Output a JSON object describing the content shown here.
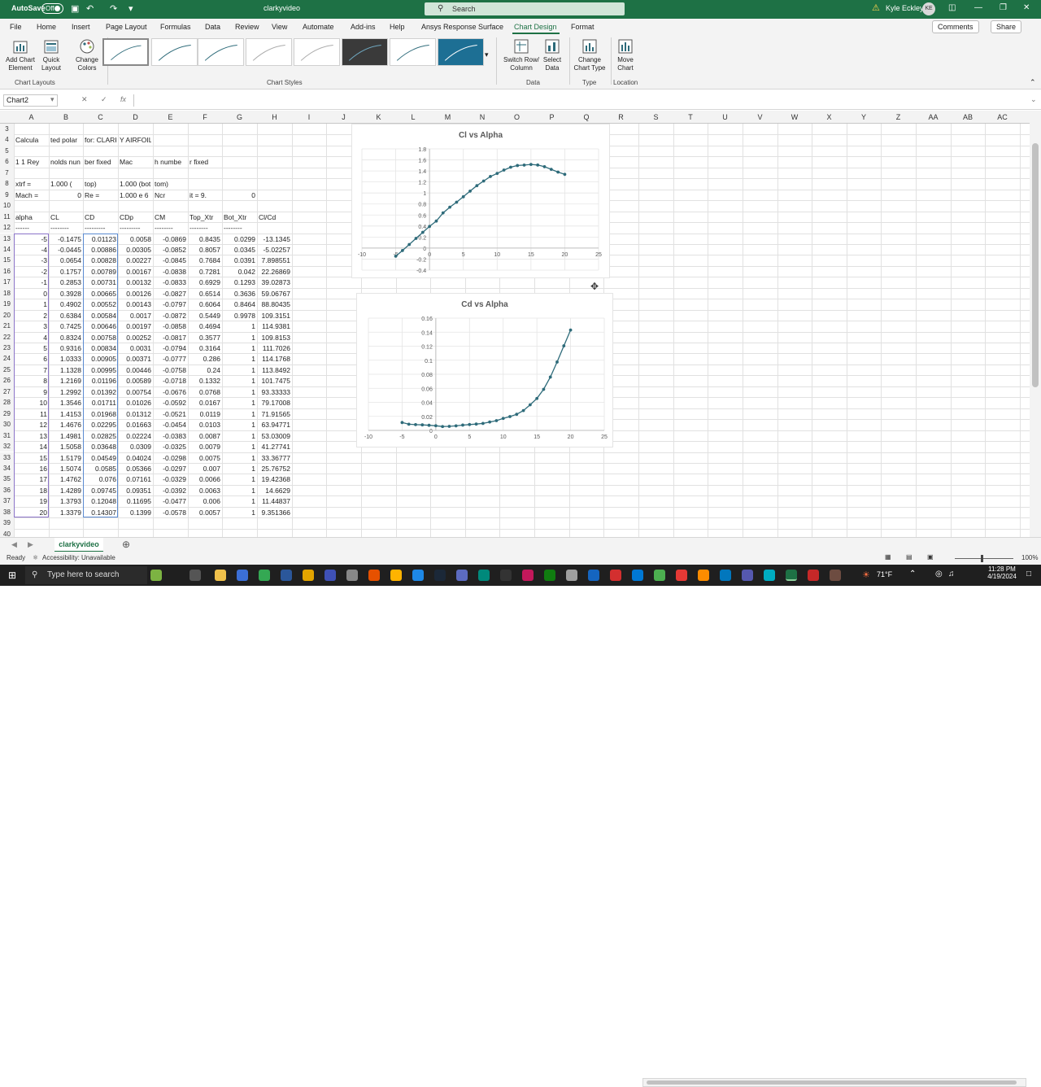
{
  "titlebar": {
    "autosave": "AutoSave",
    "toggle": "Off",
    "filename": "clarkyvideo",
    "search": "Search",
    "user": "Kyle Eckley",
    "initials": "KE"
  },
  "tabs": [
    "File",
    "Home",
    "Insert",
    "Page Layout",
    "Formulas",
    "Data",
    "Review",
    "View",
    "Automate",
    "Add-ins",
    "Help",
    "Ansys Response Surface",
    "Chart Design",
    "Format"
  ],
  "top_buttons": {
    "comments": "Comments",
    "share": "Share"
  },
  "ribbon": {
    "add_chart": "Add Chart Element",
    "quick_layout": "Quick Layout",
    "change_colors": "Change Colors",
    "switch_row": "Switch Row/ Column",
    "select_data": "Select Data",
    "change_type": "Change Chart Type",
    "move_chart": "Move Chart",
    "grp_layouts": "Chart Layouts",
    "grp_styles": "Chart Styles",
    "grp_data": "Data",
    "grp_type": "Type",
    "grp_location": "Location"
  },
  "namebox": "Chart2",
  "columns": [
    "A",
    "B",
    "C",
    "D",
    "E",
    "F",
    "G",
    "H",
    "I",
    "J",
    "K",
    "L",
    "M",
    "N",
    "O",
    "P",
    "Q",
    "R",
    "S",
    "T",
    "U",
    "V",
    "W",
    "X",
    "Y",
    "Z",
    "AA",
    "AB",
    "AC"
  ],
  "row_numbers": [
    "3",
    "4",
    "5",
    "6",
    "7",
    "8",
    "9",
    "10",
    "11",
    "12",
    "13",
    "14",
    "15",
    "16",
    "17",
    "18",
    "19",
    "20",
    "21",
    "22",
    "23",
    "24",
    "25",
    "26",
    "27",
    "28",
    "29",
    "30",
    "31",
    "32",
    "33",
    "34",
    "35",
    "36",
    "37",
    "38",
    "39",
    "40"
  ],
  "header_rows": [
    [
      "",
      "",
      "",
      "",
      "",
      "",
      "",
      ""
    ],
    [
      "Calcula",
      "ted polar",
      "for: CLARK",
      "Y AIRFOIL",
      "",
      "",
      "",
      ""
    ],
    [
      "",
      "",
      "",
      "",
      "",
      "",
      "",
      ""
    ],
    [
      "1 1 Rey",
      "nolds nun",
      "ber fixed",
      "Mac",
      "h numbe",
      "r fixed",
      "",
      ""
    ],
    [
      "",
      "",
      "",
      "",
      "",
      "",
      "",
      ""
    ],
    [
      "xtrf =",
      "1.000 (",
      "top)",
      "1.000 (bot",
      "tom)",
      "",
      "",
      ""
    ],
    [
      "Mach =",
      "0",
      "Re =",
      "1.000 e 6",
      "Ncr",
      "it =   9.",
      "0",
      ""
    ],
    [
      "",
      "",
      "",
      "",
      "",
      "",
      "",
      ""
    ],
    [
      "alpha",
      "CL",
      "CD",
      "CDp",
      "CM",
      "Top_Xtr",
      "Bot_Xtr",
      "Cl/Cd"
    ],
    [
      "------",
      "--------",
      "---------",
      "---------",
      "--------",
      "--------",
      "--------",
      ""
    ]
  ],
  "data_rows": [
    [
      "-5",
      "-0.1475",
      "0.01123",
      "0.0058",
      "-0.0869",
      "0.8435",
      "0.0299",
      "-13.1345"
    ],
    [
      "-4",
      "-0.0445",
      "0.00886",
      "0.00305",
      "-0.0852",
      "0.8057",
      "0.0345",
      "-5.02257"
    ],
    [
      "-3",
      "0.0654",
      "0.00828",
      "0.00227",
      "-0.0845",
      "0.7684",
      "0.0391",
      "7.898551"
    ],
    [
      "-2",
      "0.1757",
      "0.00789",
      "0.00167",
      "-0.0838",
      "0.7281",
      "0.042",
      "22.26869"
    ],
    [
      "-1",
      "0.2853",
      "0.00731",
      "0.00132",
      "-0.0833",
      "0.6929",
      "0.1293",
      "39.02873"
    ],
    [
      "0",
      "0.3928",
      "0.00665",
      "0.00126",
      "-0.0827",
      "0.6514",
      "0.3636",
      "59.06767"
    ],
    [
      "1",
      "0.4902",
      "0.00552",
      "0.00143",
      "-0.0797",
      "0.6064",
      "0.8464",
      "88.80435"
    ],
    [
      "2",
      "0.6384",
      "0.00584",
      "0.0017",
      "-0.0872",
      "0.5449",
      "0.9978",
      "109.3151"
    ],
    [
      "3",
      "0.7425",
      "0.00646",
      "0.00197",
      "-0.0858",
      "0.4694",
      "1",
      "114.9381"
    ],
    [
      "4",
      "0.8324",
      "0.00758",
      "0.00252",
      "-0.0817",
      "0.3577",
      "1",
      "109.8153"
    ],
    [
      "5",
      "0.9316",
      "0.00834",
      "0.0031",
      "-0.0794",
      "0.3164",
      "1",
      "111.7026"
    ],
    [
      "6",
      "1.0333",
      "0.00905",
      "0.00371",
      "-0.0777",
      "0.286",
      "1",
      "114.1768"
    ],
    [
      "7",
      "1.1328",
      "0.00995",
      "0.00446",
      "-0.0758",
      "0.24",
      "1",
      "113.8492"
    ],
    [
      "8",
      "1.2169",
      "0.01196",
      "0.00589",
      "-0.0718",
      "0.1332",
      "1",
      "101.7475"
    ],
    [
      "9",
      "1.2992",
      "0.01392",
      "0.00754",
      "-0.0676",
      "0.0768",
      "1",
      "93.33333"
    ],
    [
      "10",
      "1.3546",
      "0.01711",
      "0.01026",
      "-0.0592",
      "0.0167",
      "1",
      "79.17008"
    ],
    [
      "11",
      "1.4153",
      "0.01968",
      "0.01312",
      "-0.0521",
      "0.0119",
      "1",
      "71.91565"
    ],
    [
      "12",
      "1.4676",
      "0.02295",
      "0.01663",
      "-0.0454",
      "0.0103",
      "1",
      "63.94771"
    ],
    [
      "13",
      "1.4981",
      "0.02825",
      "0.02224",
      "-0.0383",
      "0.0087",
      "1",
      "53.03009"
    ],
    [
      "14",
      "1.5058",
      "0.03648",
      "0.0309",
      "-0.0325",
      "0.0079",
      "1",
      "41.27741"
    ],
    [
      "15",
      "1.5179",
      "0.04549",
      "0.04024",
      "-0.0298",
      "0.0075",
      "1",
      "33.36777"
    ],
    [
      "16",
      "1.5074",
      "0.0585",
      "0.05366",
      "-0.0297",
      "0.007",
      "1",
      "25.76752"
    ],
    [
      "17",
      "1.4762",
      "0.076",
      "0.07161",
      "-0.0329",
      "0.0066",
      "1",
      "19.42368"
    ],
    [
      "18",
      "1.4289",
      "0.09745",
      "0.09351",
      "-0.0392",
      "0.0063",
      "1",
      "14.6629"
    ],
    [
      "19",
      "1.3793",
      "0.12048",
      "0.11695",
      "-0.0477",
      "0.006",
      "1",
      "11.44837"
    ],
    [
      "20",
      "1.3379",
      "0.14307",
      "0.1399",
      "-0.0578",
      "0.0057",
      "1",
      "9.351366"
    ]
  ],
  "chart_data": [
    {
      "type": "scatter",
      "title": "Cl vs Alpha",
      "xlim": [
        -10,
        25
      ],
      "ylim": [
        -0.4,
        1.8
      ],
      "xticks": [
        "-10",
        "-5",
        "0",
        "5",
        "10",
        "15",
        "20",
        "25"
      ],
      "yticks": [
        "-0.4",
        "-0.2",
        "0",
        "0.2",
        "0.4",
        "0.6",
        "0.8",
        "1",
        "1.2",
        "1.4",
        "1.6",
        "1.8"
      ],
      "x": [
        -5,
        -4,
        -3,
        -2,
        -1,
        0,
        1,
        2,
        3,
        4,
        5,
        6,
        7,
        8,
        9,
        10,
        11,
        12,
        13,
        14,
        15,
        16,
        17,
        18,
        19,
        20
      ],
      "y": [
        -0.1475,
        -0.0445,
        0.0654,
        0.1757,
        0.2853,
        0.3928,
        0.4902,
        0.6384,
        0.7425,
        0.8324,
        0.9316,
        1.0333,
        1.1328,
        1.2169,
        1.2992,
        1.3546,
        1.4153,
        1.4676,
        1.4981,
        1.5058,
        1.5179,
        1.5074,
        1.4762,
        1.4289,
        1.3793,
        1.3379
      ],
      "color": "#2e6b7a"
    },
    {
      "type": "scatter",
      "title": "Cd vs Alpha",
      "xlim": [
        -10,
        25
      ],
      "ylim": [
        0,
        0.16
      ],
      "xticks": [
        "-10",
        "-5",
        "0",
        "5",
        "10",
        "15",
        "20",
        "25"
      ],
      "yticks": [
        "0",
        "0.02",
        "0.04",
        "0.06",
        "0.08",
        "0.1",
        "0.12",
        "0.14",
        "0.16"
      ],
      "x": [
        -5,
        -4,
        -3,
        -2,
        -1,
        0,
        1,
        2,
        3,
        4,
        5,
        6,
        7,
        8,
        9,
        10,
        11,
        12,
        13,
        14,
        15,
        16,
        17,
        18,
        19,
        20
      ],
      "y": [
        0.01123,
        0.00886,
        0.00828,
        0.00789,
        0.00731,
        0.00665,
        0.00552,
        0.00584,
        0.00646,
        0.00758,
        0.00834,
        0.00905,
        0.00995,
        0.01196,
        0.01392,
        0.01711,
        0.01968,
        0.02295,
        0.02825,
        0.03648,
        0.04549,
        0.0585,
        0.076,
        0.09745,
        0.12048,
        0.14307
      ],
      "color": "#2e6b7a"
    }
  ],
  "sheet": {
    "tab": "clarkyvideo"
  },
  "status": {
    "ready": "Ready",
    "accessibility": "Accessibility: Unavailable",
    "zoom": "100%"
  },
  "taskbar": {
    "search": "Type here to search",
    "weather": "71°F",
    "time": "11:28 PM",
    "date": "4/19/2024"
  }
}
